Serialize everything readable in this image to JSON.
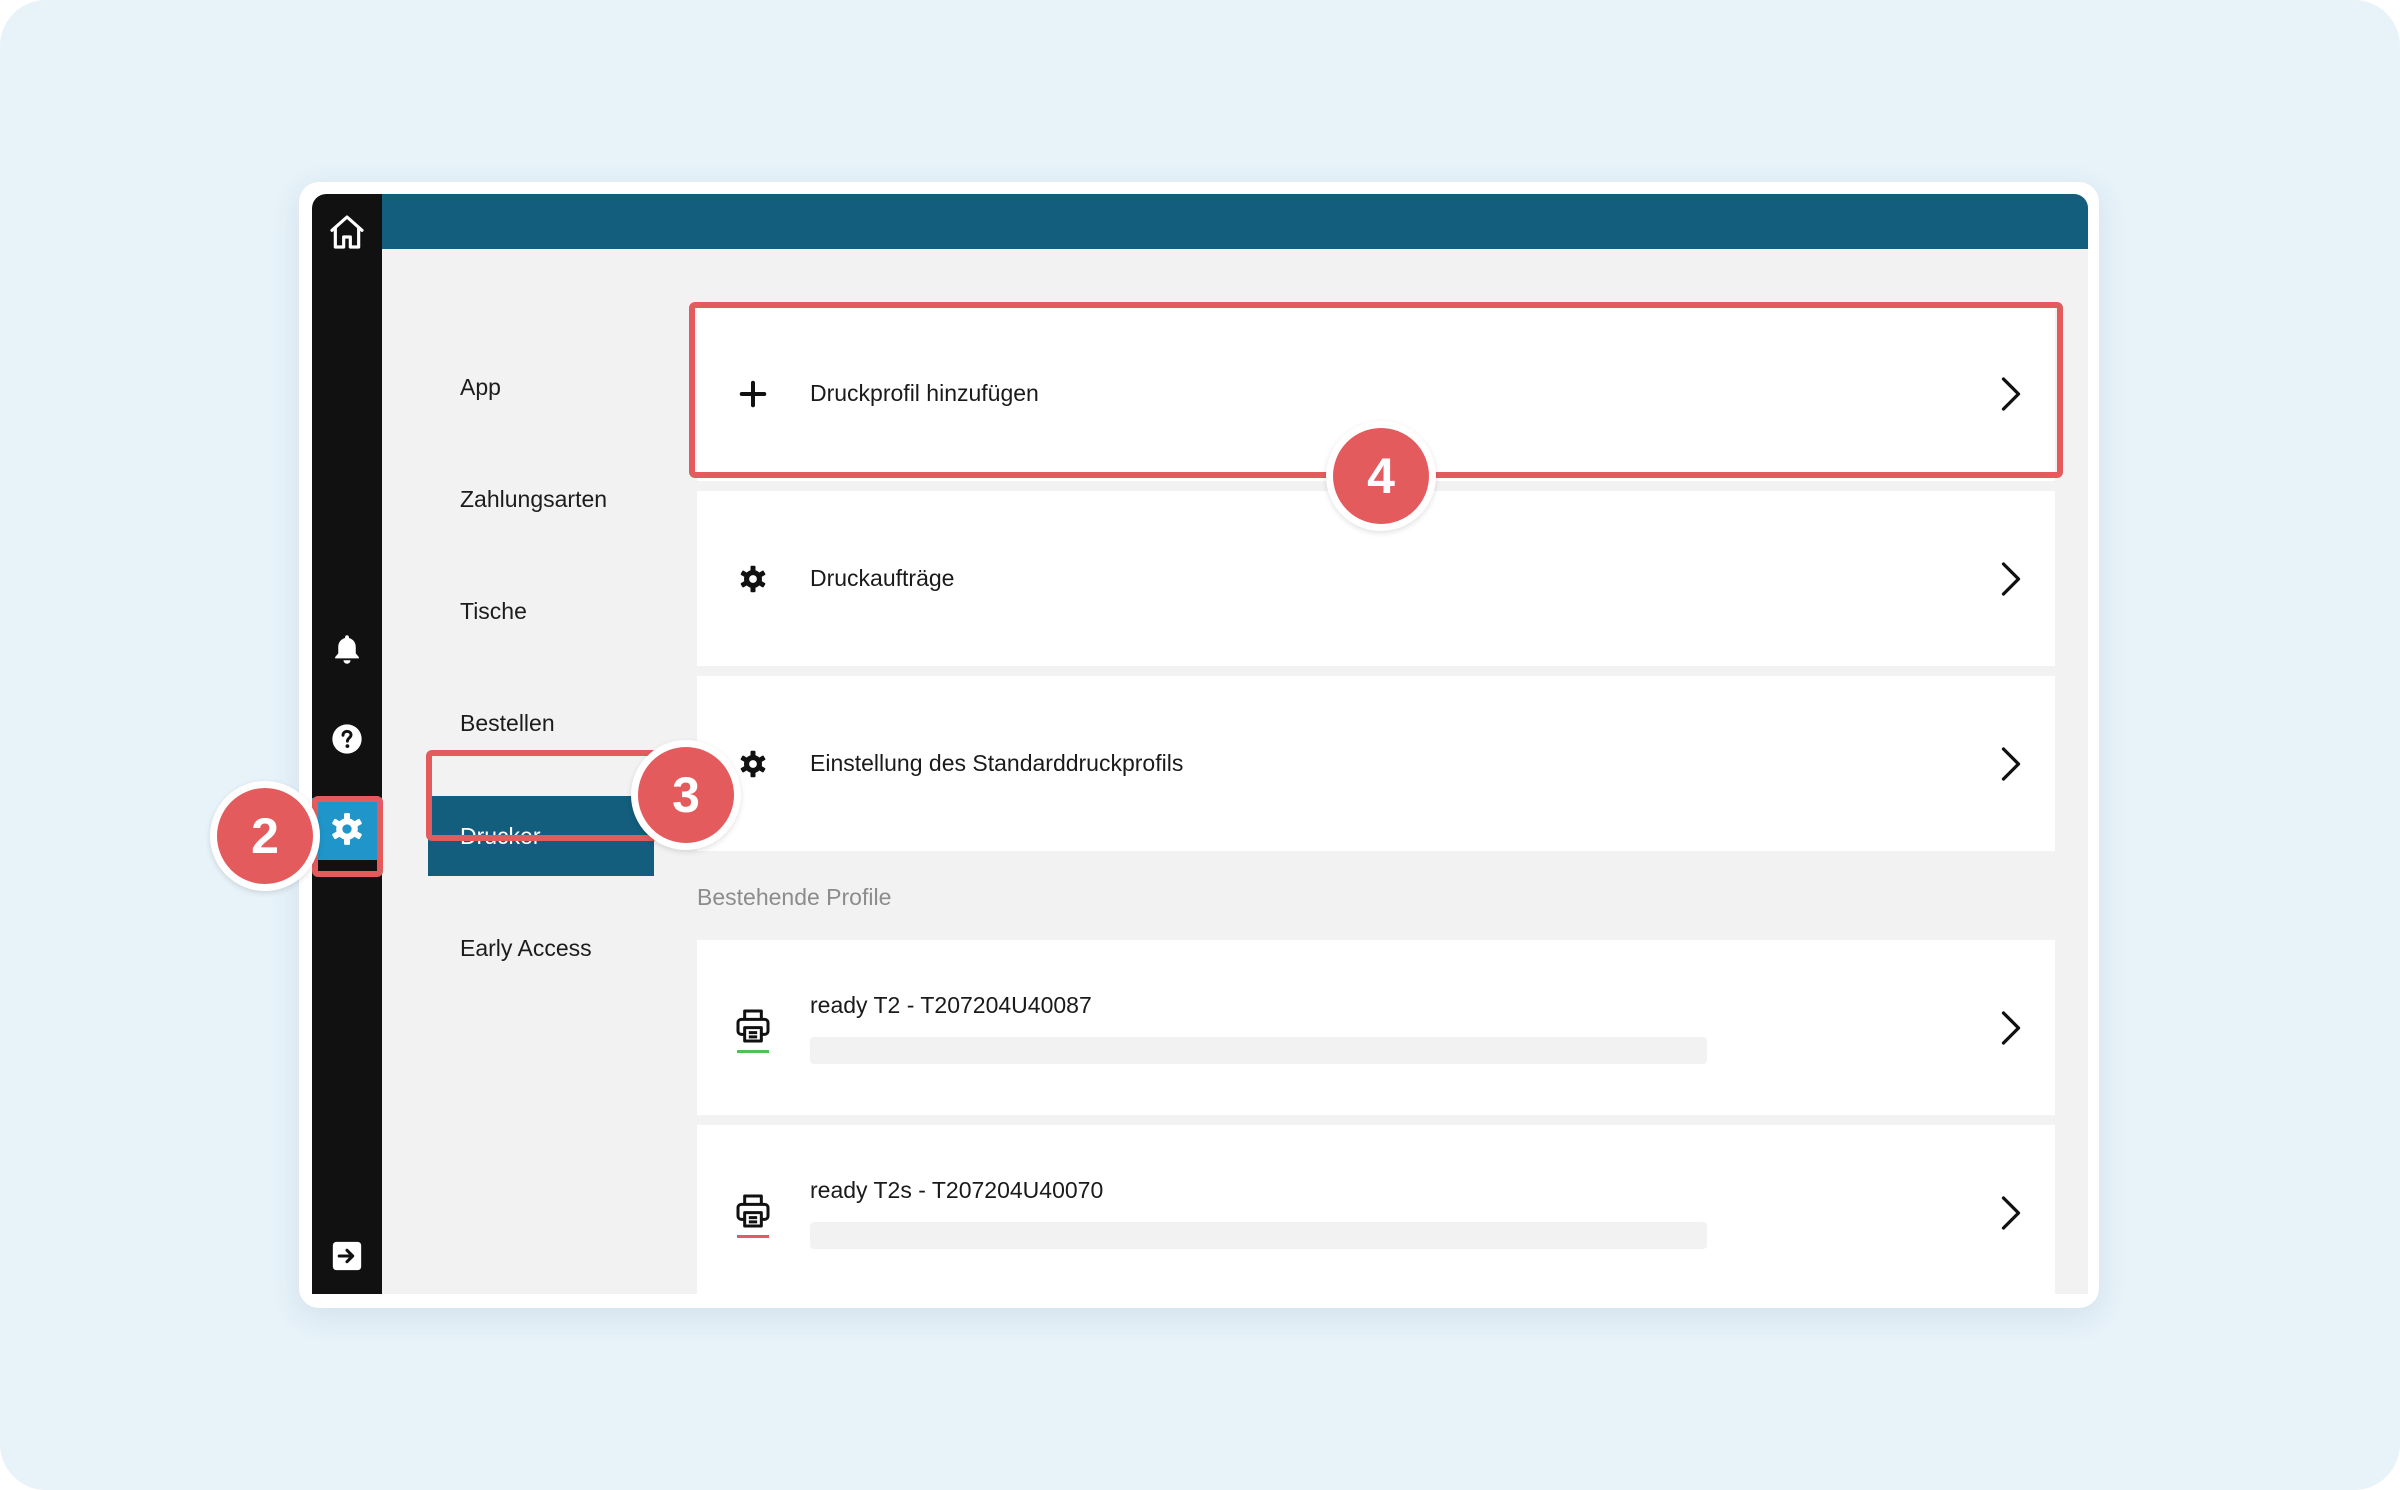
{
  "sidebar": {
    "items": [
      {
        "label": "App"
      },
      {
        "label": "Zahlungsarten"
      },
      {
        "label": "Tische"
      },
      {
        "label": "Bestellen"
      },
      {
        "label": "Drucker"
      },
      {
        "label": "Early Access"
      }
    ]
  },
  "rail": {
    "icons": [
      "home-icon",
      "bell-icon",
      "help-icon",
      "gear-icon",
      "logout-icon"
    ],
    "active": "gear-icon",
    "active_color": "#1f95c9"
  },
  "actions": [
    {
      "icon": "plus-icon",
      "label": "Druckprofil hinzufügen"
    },
    {
      "icon": "gear-icon",
      "label": "Druckaufträge"
    },
    {
      "icon": "gear-icon",
      "label": "Einstellung des Standarddruckprofils"
    }
  ],
  "profiles_section": {
    "label": "Bestehende Profile",
    "items": [
      {
        "name": "ready T2 - T207204U40087",
        "status_color": "#4cc35a"
      },
      {
        "name": "ready T2s - T207204U40070",
        "status_color": "#e45b5e"
      }
    ]
  },
  "annotations": [
    {
      "number": "2"
    },
    {
      "number": "3"
    },
    {
      "number": "4"
    }
  ],
  "colors": {
    "brand": "#135e7d",
    "accent": "#1f95c9",
    "annotation": "#e45b5e",
    "page_background": "#e7f2f9"
  }
}
